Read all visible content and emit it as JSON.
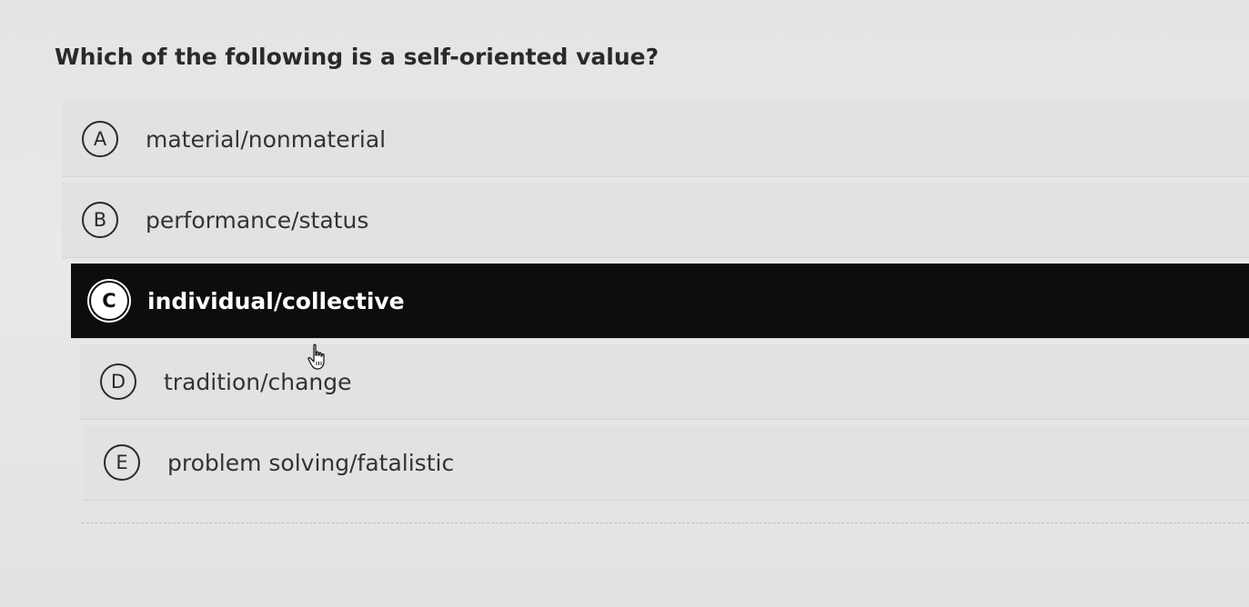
{
  "question": "Which of the following is a self-oriented value?",
  "options": [
    {
      "letter": "A",
      "label": "material/nonmaterial"
    },
    {
      "letter": "B",
      "label": "performance/status"
    },
    {
      "letter": "C",
      "label": "individual/collective"
    },
    {
      "letter": "D",
      "label": "tradition/change"
    },
    {
      "letter": "E",
      "label": "problem solving/fatalistic"
    }
  ],
  "selected": "C"
}
